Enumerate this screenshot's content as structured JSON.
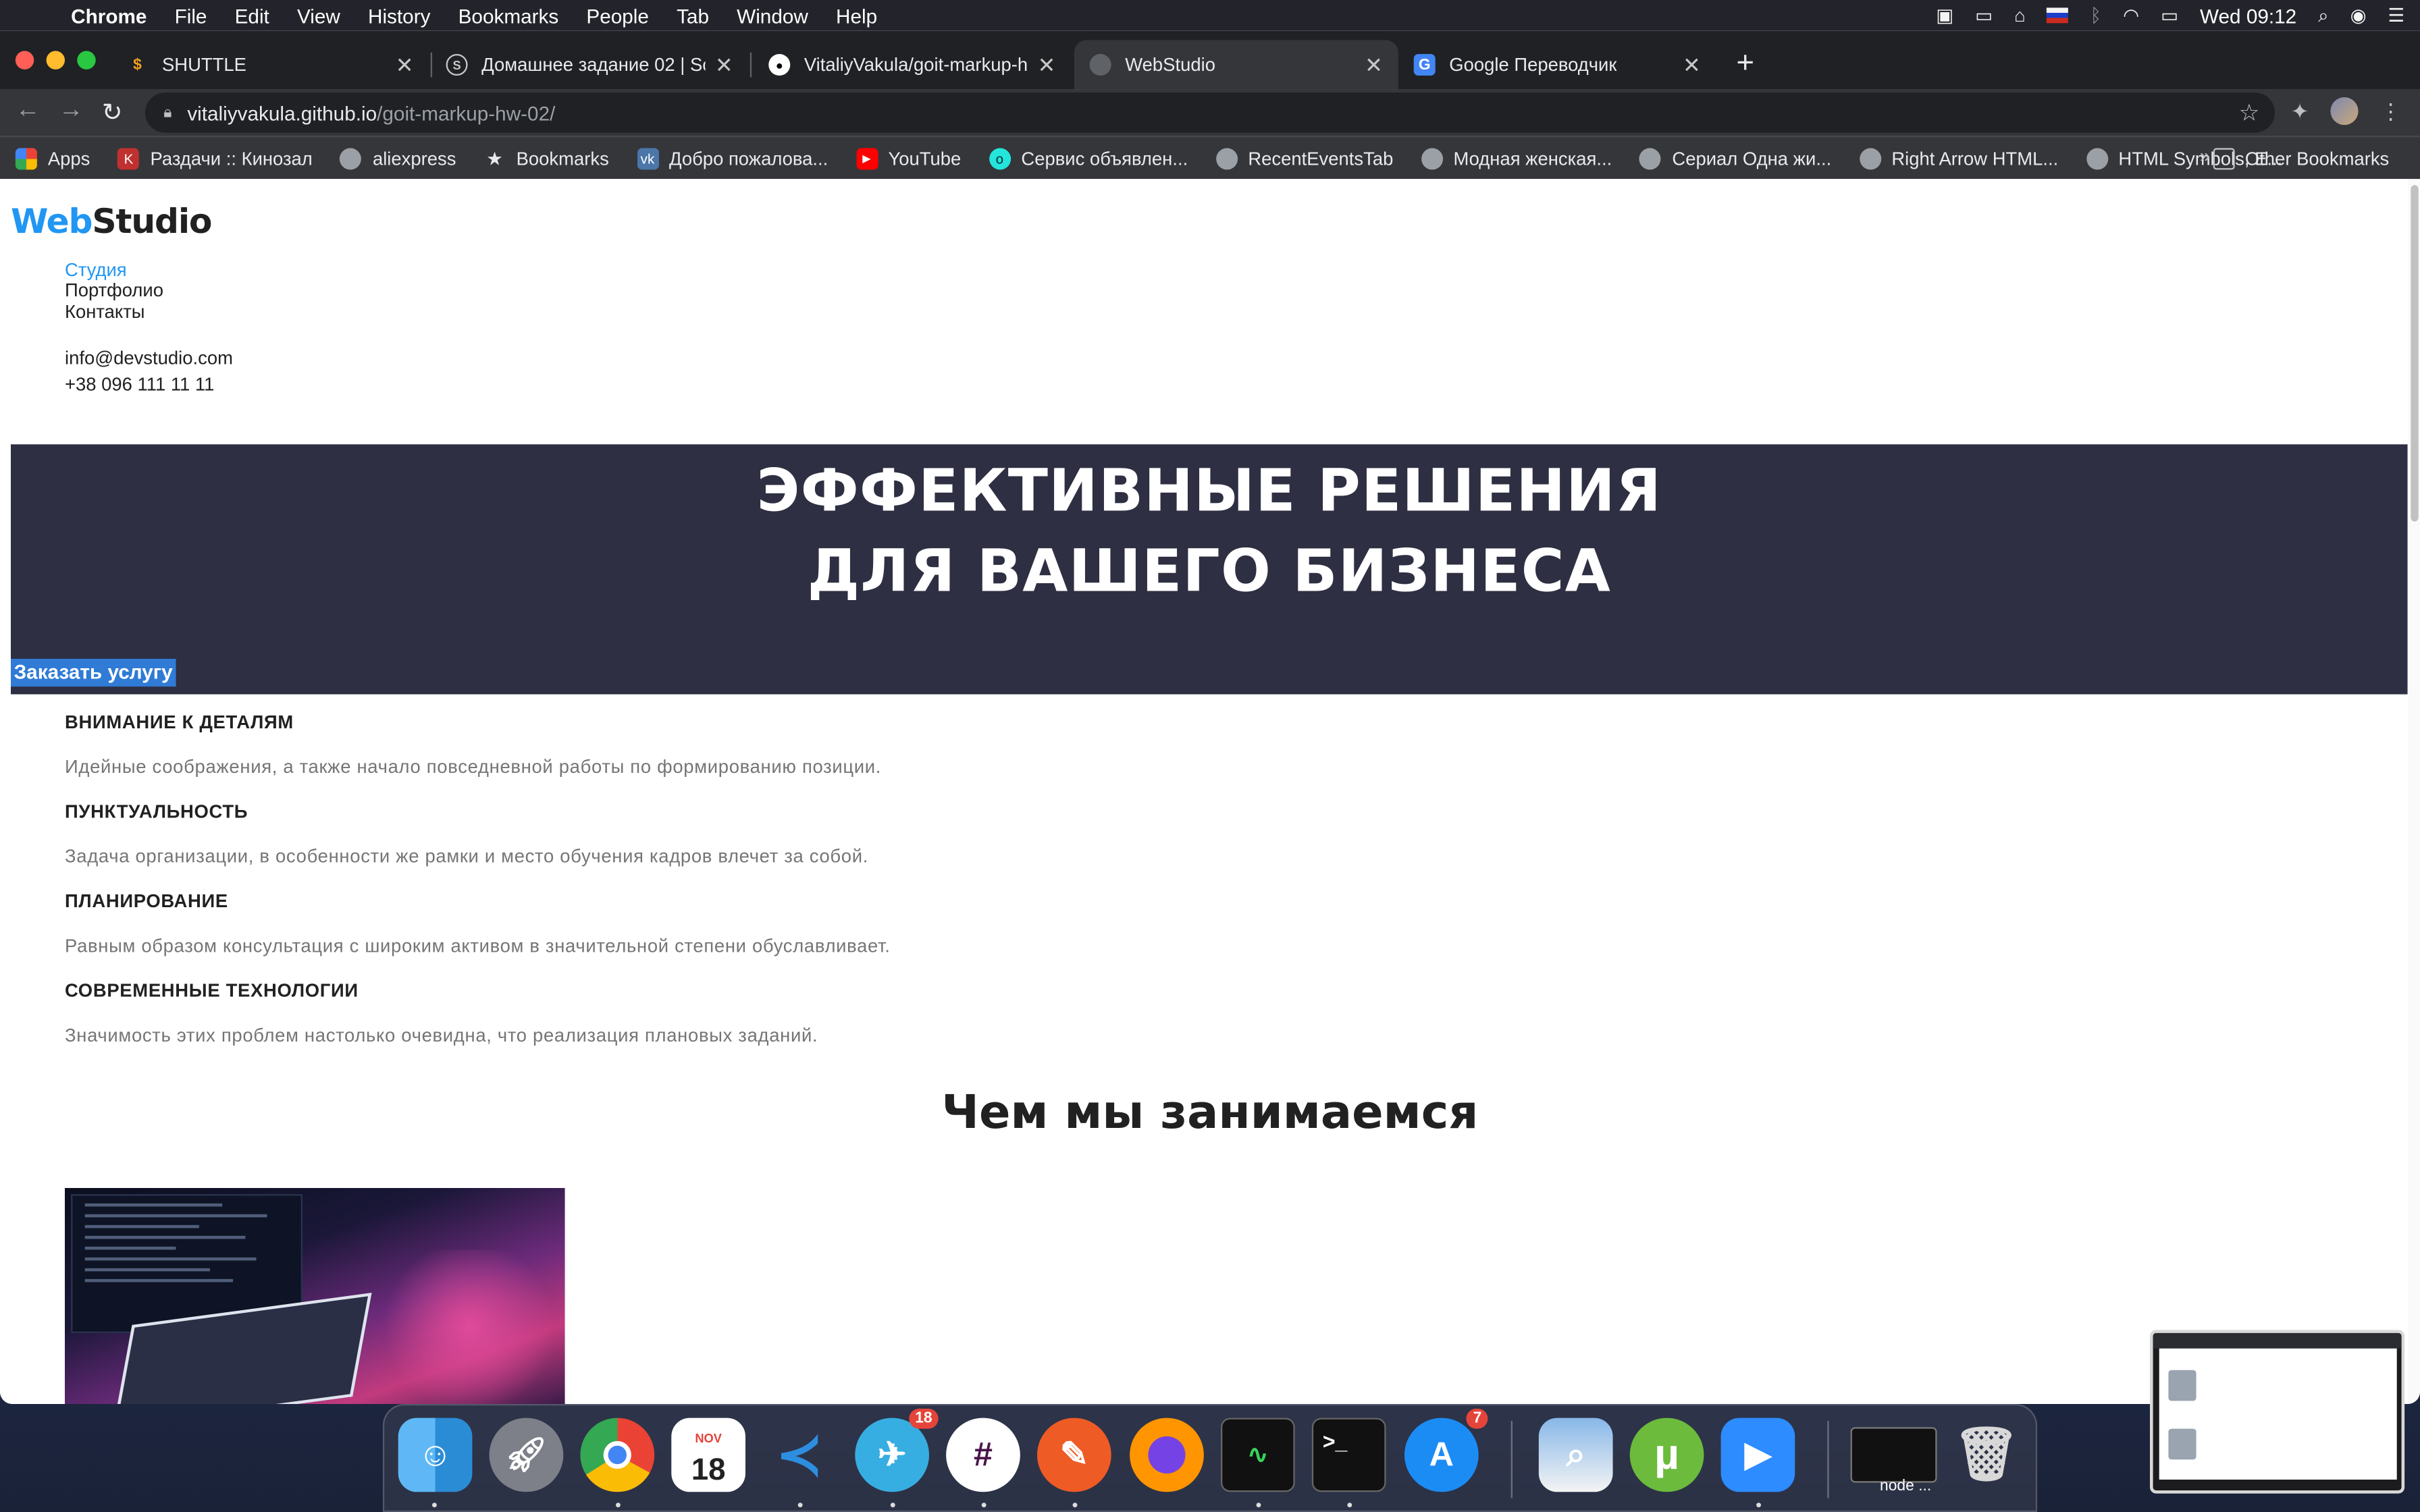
{
  "menubar": {
    "app": "Chrome",
    "items": [
      "File",
      "Edit",
      "View",
      "History",
      "Bookmarks",
      "People",
      "Tab",
      "Window",
      "Help"
    ],
    "clock": "Wed 09:12"
  },
  "tabs": [
    {
      "title": "SHUTTLE",
      "favicon": "S",
      "color": "#f0a020"
    },
    {
      "title": "Домашнее задание 02 | Scho",
      "favicon": "S",
      "color": "#9aa0a6"
    },
    {
      "title": "VitaliyVakula/goit-markup-hw-",
      "favicon": "gh",
      "color": "#ffffff"
    },
    {
      "title": "WebStudio",
      "favicon": "globe",
      "color": "#5f6368"
    },
    {
      "title": "Google Переводчик",
      "favicon": "G",
      "color": "#4285f4"
    }
  ],
  "address": {
    "host": "vitaliyvakula.github.io",
    "path": "/goit-markup-hw-02/"
  },
  "bookmarks": {
    "items": [
      "Apps",
      "Раздачи :: Кинозал",
      "aliexpress",
      "Bookmarks",
      "Добро пожалова...",
      "YouTube",
      "Сервис объявлен...",
      "RecentEventsTab",
      "Модная женская...",
      "Сериал Одна жи...",
      "Right Arrow HTML...",
      "HTML Symbols, E..."
    ],
    "overflow": "»",
    "other": "Other Bookmarks"
  },
  "site": {
    "logo_a": "Web",
    "logo_b": "Studio",
    "nav": [
      "Студия",
      "Портфолио",
      "Контакты"
    ],
    "email": "info@devstudio.com",
    "phone": "+38 096 111 11 11",
    "hero_line1": "ЭФФЕКТИВНЫЕ РЕШЕНИЯ",
    "hero_line2": "ДЛЯ ВАШЕГО БИЗНЕСА",
    "hero_button": "Заказать услугу",
    "features": [
      {
        "title": "ВНИМАНИЕ К ДЕТАЛЯМ",
        "text": "Идейные соображения, а также начало повседневной работы по формированию позиции."
      },
      {
        "title": "ПУНКТУАЛЬНОСТЬ",
        "text": "Задача организации, в особенности же рамки и место обучения кадров влечет за собой."
      },
      {
        "title": "ПЛАНИРОВАНИЕ",
        "text": "Равным образом консультация с широким активом в значительной степени обуславливает."
      },
      {
        "title": "СОВРЕМЕННЫЕ ТЕХНОЛОГИИ",
        "text": "Значимость этих проблем настолько очевидна, что реализация плановых заданий."
      }
    ],
    "section_title": "Чем мы занимаемся"
  },
  "dock": {
    "apps": [
      "Finder",
      "Launchpad",
      "Chrome",
      "Calendar",
      "VS Code",
      "Telegram",
      "Slack",
      "Postman",
      "Firefox",
      "Activity Monitor",
      "Terminal",
      "App Store",
      "Preview",
      "uTorrent",
      "Zoom",
      "node",
      "Trash"
    ],
    "calendar_month": "NOV",
    "calendar_day": "18",
    "telegram_badge": "18",
    "appstore_badge": "7",
    "node_label": "node ..."
  }
}
